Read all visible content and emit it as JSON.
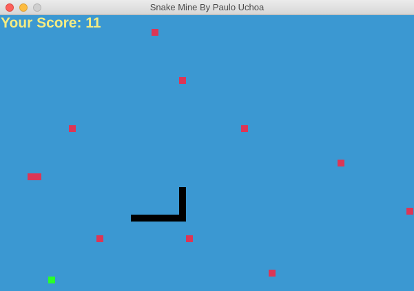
{
  "window": {
    "title": "Snake Mine By Paulo Uchoa"
  },
  "game": {
    "score_label": "Your Score: 11",
    "score": 11,
    "colors": {
      "background": "#3b98d2",
      "mine": "#dc3656",
      "food": "#29ff29",
      "snake": "#000000",
      "score_text": "#f5ec82"
    },
    "cell_size_units": 10
  }
}
